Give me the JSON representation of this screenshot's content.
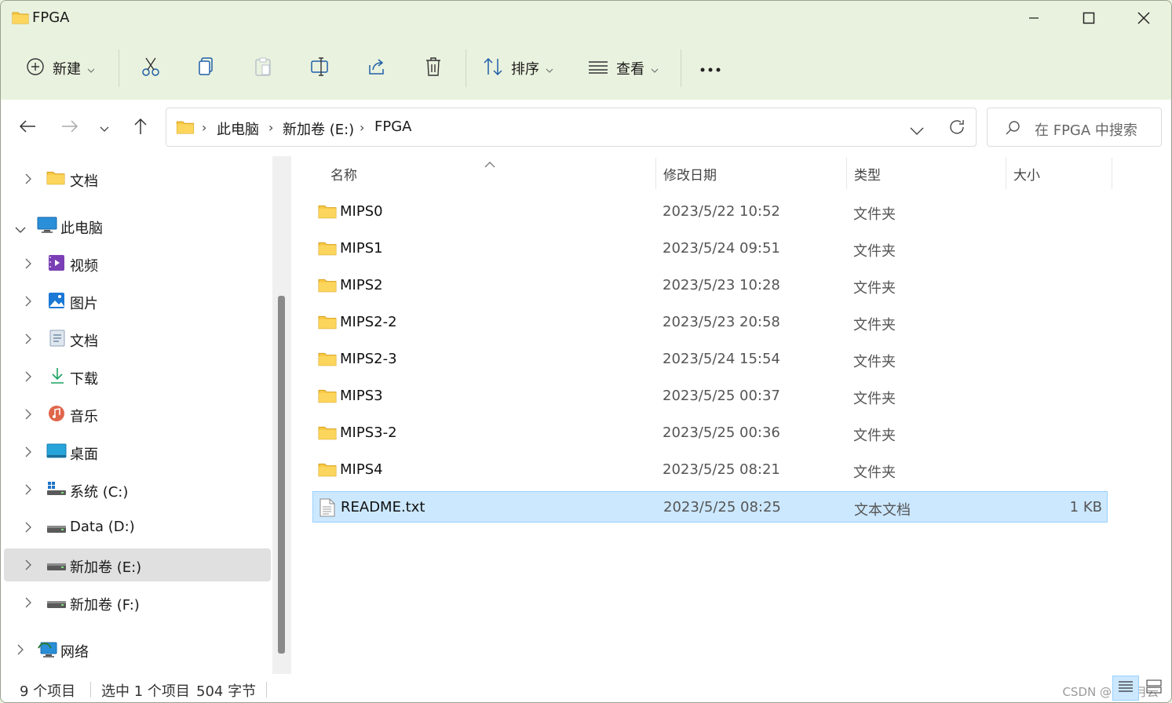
{
  "window": {
    "title": "FPGA"
  },
  "toolbar": {
    "new_label": "新建",
    "sort_label": "排序",
    "view_label": "查看"
  },
  "address": {
    "crumbs": [
      "此电脑",
      "新加卷 (E:)",
      "FPGA"
    ],
    "search_placeholder": "在 FPGA 中搜索"
  },
  "sidebar": {
    "items": [
      {
        "label": "文档",
        "icon": "folder-icon"
      },
      {
        "label": "此电脑",
        "icon": "computer-icon"
      },
      {
        "label": "视频",
        "icon": "video-icon"
      },
      {
        "label": "图片",
        "icon": "pictures-icon"
      },
      {
        "label": "文档",
        "icon": "documents-icon"
      },
      {
        "label": "下载",
        "icon": "download-icon"
      },
      {
        "label": "音乐",
        "icon": "music-icon"
      },
      {
        "label": "桌面",
        "icon": "desktop-icon"
      },
      {
        "label": "系统 (C:)",
        "icon": "system-drive-icon"
      },
      {
        "label": "Data (D:)",
        "icon": "drive-icon"
      },
      {
        "label": "新加卷 (E:)",
        "icon": "drive-icon"
      },
      {
        "label": "新加卷 (F:)",
        "icon": "drive-icon"
      },
      {
        "label": "网络",
        "icon": "network-icon"
      }
    ]
  },
  "columns": {
    "name": "名称",
    "modified": "修改日期",
    "type": "类型",
    "size": "大小"
  },
  "files": [
    {
      "name": "MIPS0",
      "date": "2023/5/22 10:52",
      "type": "文件夹",
      "size": ""
    },
    {
      "name": "MIPS1",
      "date": "2023/5/24 09:51",
      "type": "文件夹",
      "size": ""
    },
    {
      "name": "MIPS2",
      "date": "2023/5/23 10:28",
      "type": "文件夹",
      "size": ""
    },
    {
      "name": "MIPS2-2",
      "date": "2023/5/23 20:58",
      "type": "文件夹",
      "size": ""
    },
    {
      "name": "MIPS2-3",
      "date": "2023/5/24 15:54",
      "type": "文件夹",
      "size": ""
    },
    {
      "name": "MIPS3",
      "date": "2023/5/25 00:37",
      "type": "文件夹",
      "size": ""
    },
    {
      "name": "MIPS3-2",
      "date": "2023/5/25 00:36",
      "type": "文件夹",
      "size": ""
    },
    {
      "name": "MIPS4",
      "date": "2023/5/25 08:21",
      "type": "文件夹",
      "size": ""
    },
    {
      "name": "README.txt",
      "date": "2023/5/25 08:25",
      "type": "文本文档",
      "size": "1 KB"
    }
  ],
  "status": {
    "item_count": "9 个项目",
    "selection": "选中 1 个项目",
    "selection_size": "504 字节",
    "watermark": "CSDN @日暮月云"
  },
  "colors": {
    "chrome": "#e9f2de",
    "selection": "#cce8ff",
    "selection_border": "#99d1ff",
    "folder": "#f8c844"
  }
}
